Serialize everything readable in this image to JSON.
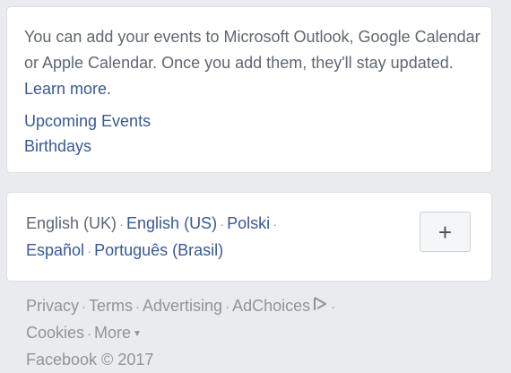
{
  "events_card": {
    "description": "You can add your events to Microsoft Outlook, Google Calendar or Apple Calendar. Once you add them, they'll stay updated.",
    "learn_more": "Learn more.",
    "upcoming_events": "Upcoming Events",
    "birthdays": "Birthdays"
  },
  "languages": {
    "current": "English (UK)",
    "options": [
      "English (US)",
      "Polski",
      "Español",
      "Português (Brasil)"
    ],
    "add_label": "+"
  },
  "footer": {
    "privacy": "Privacy",
    "terms": "Terms",
    "advertising": "Advertising",
    "adchoices": "AdChoices",
    "cookies": "Cookies",
    "more": "More",
    "copyright": "Facebook © 2017"
  },
  "colors": {
    "link": "#385898",
    "muted": "#90949c",
    "text": "#606770",
    "background": "#e9ebee"
  }
}
